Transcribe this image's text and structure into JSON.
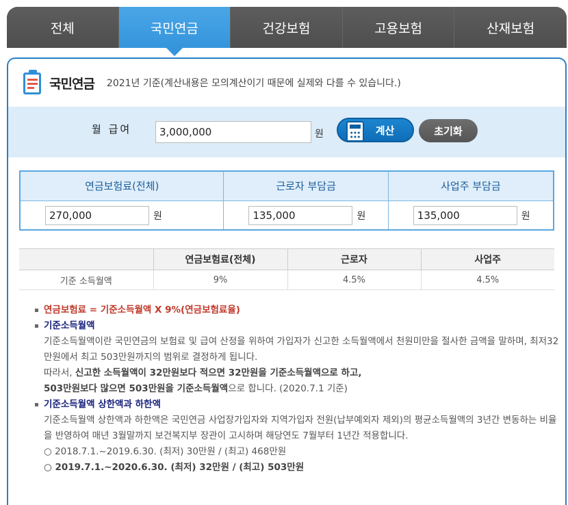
{
  "tabs": [
    {
      "label": "전체",
      "active": false
    },
    {
      "label": "국민연금",
      "active": true
    },
    {
      "label": "건강보험",
      "active": false
    },
    {
      "label": "고용보험",
      "active": false
    },
    {
      "label": "산재보험",
      "active": false
    }
  ],
  "header": {
    "title": "국민연금",
    "note": "2021년 기준(계산내용은 모의계산이기 때문에 실제와 다를 수 있습니다.)"
  },
  "form": {
    "salary_label": "월 급여",
    "salary_value": "3,000,000",
    "unit": "원",
    "calc_label": "계산",
    "reset_label": "초기화"
  },
  "result": {
    "headers": [
      "연금보험료(전체)",
      "근로자 부담금",
      "사업주 부담금"
    ],
    "values": [
      "270,000",
      "135,000",
      "135,000"
    ],
    "unit": "원"
  },
  "rates": {
    "headers": [
      "",
      "연금보험료(전체)",
      "근로자",
      "사업주"
    ],
    "row": [
      "기준 소득월액",
      "9%",
      "4.5%",
      "4.5%"
    ]
  },
  "notes": {
    "formula": "연금보험료 = 기준소득월액 X 9%(연금보험료율)",
    "section1_title": "기준소득월액",
    "section1_text": "기준소득월액이란 국민연금의 보험료 및 급여 산정을 위하여 가입자가 신고한 소득월액에서 천원미만을 절사한 금액을 말하며, 최저32만원에서 최고 503만원까지의 범위로 결정하게 됩니다.",
    "section1_line2_prefix": "따라서, ",
    "section1_line2_bold": "신고한 소득월액이 32만원보다 적으면 32만원을 기준소득월액으로 하고,",
    "section1_line3_bold": "503만원보다 많으면 503만원을 기준소득월액",
    "section1_line3_tail": "으로 합니다. (2020.7.1 기준)",
    "section2_title": "기준소득월액 상한액과 하한액",
    "section2_text": "기준소득월액 상한액과 하한액은 국민연금 사업장가입자와 지역가입자 전원(납부예외자 제외)의 평균소득월액의 3년간 변동하는 비율을 반영하여 매년 3월말까지 보건복지부 장관이 고시하며 해당연도 7월부터 1년간 적용합니다.",
    "range1": "○ 2018.7.1.~2019.6.30. (최저) 30만원 / (최고) 468만원",
    "range2": "○ 2019.7.1.~2020.6.30. (최저) 32만원 / (최고) 503만원"
  }
}
